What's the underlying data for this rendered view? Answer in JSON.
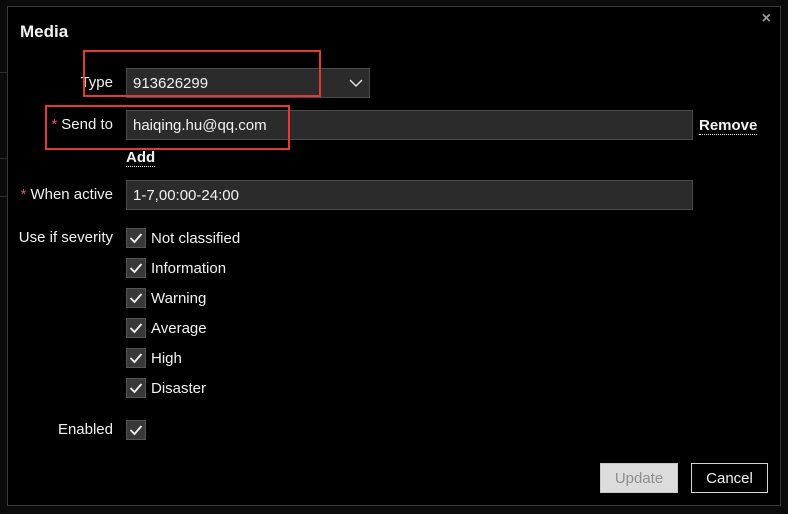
{
  "dialog": {
    "title": "Media",
    "close_glyph": "×"
  },
  "form": {
    "type": {
      "label": "Type",
      "value": "913626299"
    },
    "send_to": {
      "label": "Send to",
      "value": "haiqing.hu@qq.com",
      "remove_label": "Remove",
      "add_label": "Add"
    },
    "when_active": {
      "label": "When active",
      "value": "1-7,00:00-24:00"
    },
    "severity": {
      "label": "Use if severity",
      "options": [
        {
          "label": "Not classified",
          "checked": true
        },
        {
          "label": "Information",
          "checked": true
        },
        {
          "label": "Warning",
          "checked": true
        },
        {
          "label": "Average",
          "checked": true
        },
        {
          "label": "High",
          "checked": true
        },
        {
          "label": "Disaster",
          "checked": true
        }
      ]
    },
    "enabled": {
      "label": "Enabled",
      "checked": true
    }
  },
  "buttons": {
    "update": "Update",
    "cancel": "Cancel"
  },
  "required_mark": "*",
  "colors": {
    "background": "#000000",
    "input_bg": "#2b2b2b",
    "required": "#e45959",
    "annotation": "#e53935"
  }
}
